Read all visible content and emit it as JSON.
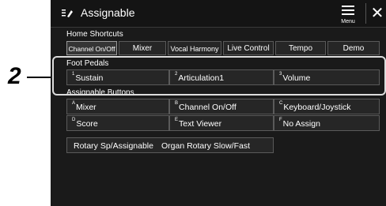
{
  "annotation": {
    "step": "2"
  },
  "header": {
    "title": "Assignable",
    "menu_label": "Menu",
    "close_glyph": "✕"
  },
  "home_shortcuts": {
    "title": "Home Shortcuts",
    "tabs": [
      "Channel On/Off",
      "Mixer",
      "Vocal Harmony",
      "Live Control",
      "Tempo",
      "Demo"
    ],
    "selected": "Channel On/Off"
  },
  "foot_pedals": {
    "title": "Foot Pedals",
    "items": [
      {
        "num": "1",
        "label": "Sustain"
      },
      {
        "num": "2",
        "label": "Articulation1"
      },
      {
        "num": "3",
        "label": "Volume"
      }
    ]
  },
  "assignable_buttons": {
    "title": "Assignable Buttons",
    "items": [
      {
        "key": "A",
        "label": "Mixer"
      },
      {
        "key": "B",
        "label": "Channel On/Off"
      },
      {
        "key": "C",
        "label": "Keyboard/Joystick"
      },
      {
        "key": "D",
        "label": "Score"
      },
      {
        "key": "E",
        "label": "Text Viewer"
      },
      {
        "key": "F",
        "label": "No Assign"
      }
    ]
  },
  "rotary": {
    "label": "Rotary Sp/Assignable",
    "value": "Organ Rotary Slow/Fast"
  },
  "colors": {
    "screen_bg": "#1a1a1a",
    "cell_bg": "#262626",
    "border": "#5a5a5a",
    "text": "#ffffff"
  },
  "icons": [
    "assignable-icon",
    "menu-icon",
    "close-icon"
  ]
}
